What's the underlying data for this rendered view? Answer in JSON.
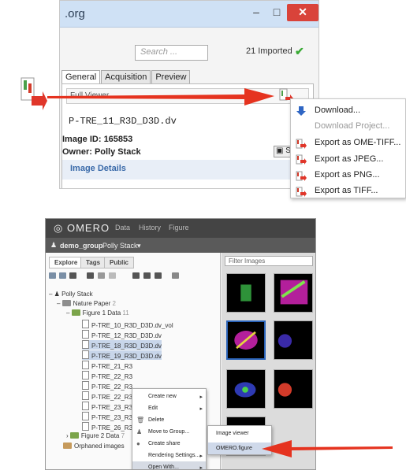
{
  "top_window": {
    "title": ".org",
    "min_label": "–",
    "max_label": "□",
    "close_label": "✕",
    "search_placeholder": "Search ...",
    "imported_text": "21 Imported",
    "tabs": [
      "General",
      "Acquisition",
      "Preview"
    ],
    "full_viewer_label": "Full Viewer",
    "image_name": "P-TRE_11_R3D_D3D.dv",
    "image_id": "Image ID: 165853",
    "owner": "Owner: Polly Stack",
    "share_button": "Sh",
    "image_details": "Image Details"
  },
  "export_menu": {
    "items": [
      {
        "label": "Download...",
        "enabled": true,
        "icon": "download-arrow-icon"
      },
      {
        "label": "Download Project...",
        "enabled": false,
        "icon": "none"
      },
      {
        "label": "Export as OME-TIFF...",
        "enabled": true,
        "icon": "export-icon"
      },
      {
        "label": "Export as JPEG...",
        "enabled": true,
        "icon": "export-icon"
      },
      {
        "label": "Export as PNG...",
        "enabled": true,
        "icon": "export-icon"
      },
      {
        "label": "Export as TIFF...",
        "enabled": true,
        "icon": "export-icon"
      }
    ]
  },
  "omero": {
    "logo": "OMERO",
    "nav": [
      "Data",
      "History",
      "Figure"
    ],
    "group": "demo_group",
    "user": "Polly Stack",
    "subtabs": [
      "Explore",
      "Tags",
      "Public"
    ],
    "filter_placeholder": "Filter Images",
    "tree": {
      "user": "Polly Stack",
      "project": "Nature Paper",
      "project_count": "2",
      "dataset1": "Figure 1 Data",
      "dataset1_count": "11",
      "images": [
        "P-TRE_10_R3D_D3D.dv_vol",
        "P-TRE_12_R3D_D3D.dv",
        "P-TRE_18_R3D_D3D.dv",
        "P-TRE_19_R3D_D3D.dv",
        "P-TRE_21_R3",
        "P-TRE_22_R3",
        "P-TRE_22_R3",
        "P-TRE_22_R3",
        "P-TRE_23_R3",
        "P-TRE_23_R3",
        "P-TRE_26_R3"
      ],
      "dataset2": "Figure 2 Data",
      "dataset2_count": "7",
      "orphaned": "Orphaned images"
    },
    "context_menu": [
      "Create new",
      "Edit",
      "Delete",
      "Move to Group...",
      "Create share",
      "Rendering Settings...",
      "Open With..."
    ],
    "submenu": [
      "Image viewer",
      "OMERO.figure"
    ]
  },
  "colors": {
    "accent_red": "#e5331f",
    "titlebar": "#cfe1f5",
    "omero_dark": "#444444"
  }
}
